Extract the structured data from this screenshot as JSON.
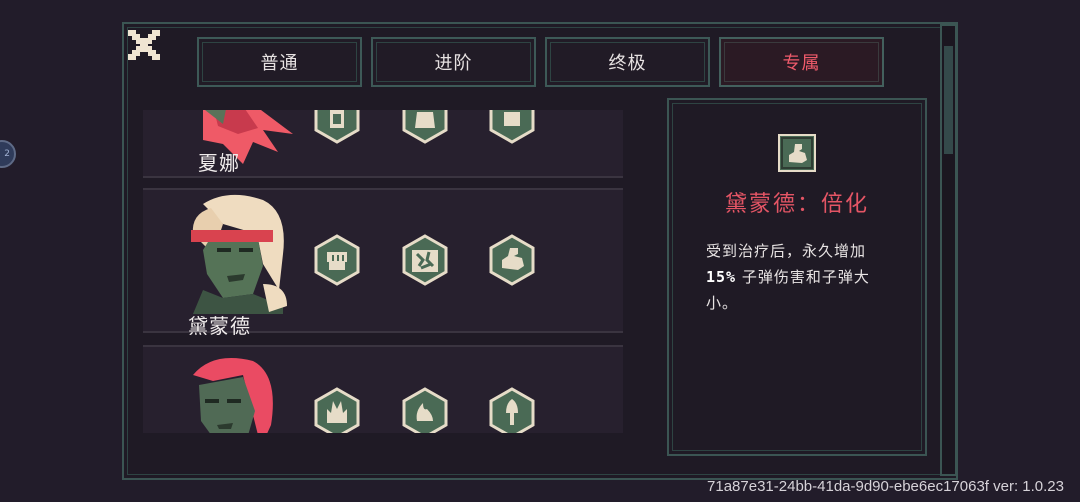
{
  "tabs": [
    "普通",
    "进阶",
    "终极",
    "专属"
  ],
  "active_tab_index": 3,
  "characters": [
    {
      "name": "夏娜",
      "hair_color": "#ef5a67",
      "skin_color": "#4f6a54",
      "skills": [
        "scroll-icon",
        "horn-icon",
        "fist-scroll-icon"
      ]
    },
    {
      "name": "黛蒙德",
      "hair_color": "#efdcc0",
      "skin_color": "#557357",
      "skills": [
        "fist-icon",
        "cracked-rock-icon",
        "flex-arm-icon"
      ]
    },
    {
      "name": "",
      "hair_color": "#ea4b63",
      "skin_color": "#506a55",
      "skills": [
        "flame-face-icon",
        "fire-icon",
        "torch-icon"
      ]
    }
  ],
  "detail": {
    "icon": "flex-arm-icon",
    "title": "黛蒙德：倍化",
    "desc_before": "受到治疗后，永久增加",
    "desc_value": "15%",
    "desc_after": "子弹伤害和子弹大小。"
  },
  "version_text": "71a87e31-24bb-41da-9d90-ebe6ec17063f ver: 1.0.23",
  "colors": {
    "accent": "#ef5b6b",
    "border": "#3b5553",
    "panel_bg": "#1f1a25",
    "icon_light": "#e6dcc8",
    "icon_dark": "#4a6a55"
  }
}
